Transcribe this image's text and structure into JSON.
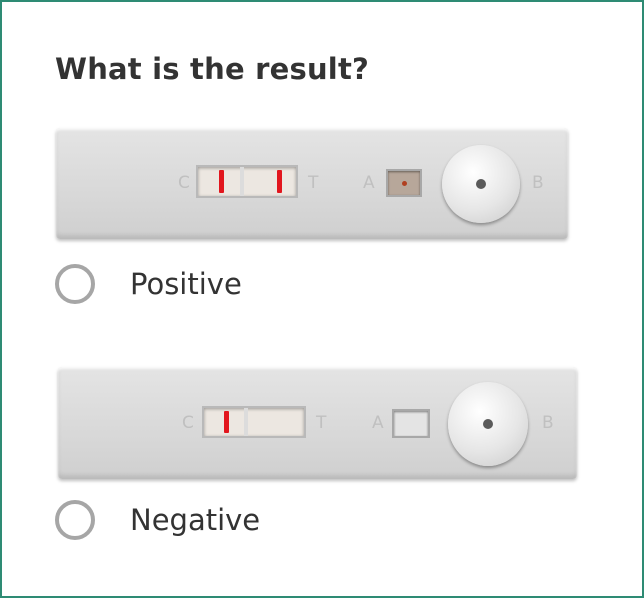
{
  "question": {
    "title": "What is the result?"
  },
  "options": [
    {
      "label": "Positive",
      "selected": false,
      "test_image": {
        "markings": {
          "control": "C",
          "test": "T",
          "well_a": "A",
          "well_b": "B"
        },
        "red_lines": [
          "control",
          "test"
        ],
        "line_color": "#e2161d"
      }
    },
    {
      "label": "Negative",
      "selected": false,
      "test_image": {
        "markings": {
          "control": "C",
          "test": "T",
          "well_a": "A",
          "well_b": "B"
        },
        "red_lines": [
          "control"
        ],
        "line_color": "#e2161d"
      }
    }
  ],
  "colors": {
    "frame_border": "#2e8b74",
    "text": "#333333",
    "radio_border": "#a6a6a6"
  }
}
